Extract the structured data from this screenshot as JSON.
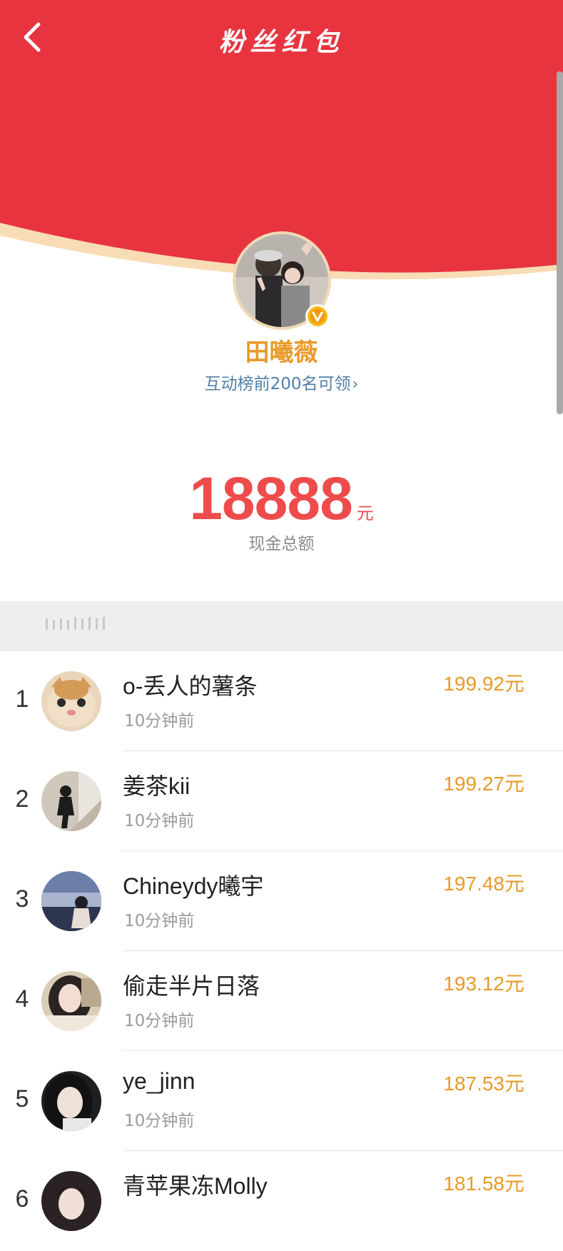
{
  "header": {
    "title": "粉丝红包",
    "back_icon": "chevron-left-icon",
    "background_color": "#e7343f",
    "rim_color": "#f7dcb5"
  },
  "host": {
    "name": "田曦薇",
    "badge_icon": "verified-v-badge-icon",
    "hint": "互动榜前200名可领"
  },
  "amount": {
    "value": "18888",
    "unit": "元",
    "label": "现金总额",
    "color": "#ee4c4c"
  },
  "list": {
    "items": [
      {
        "rank": "1",
        "name": "o-丢人的薯条",
        "time": "10分钟前",
        "amount": "199.92元"
      },
      {
        "rank": "2",
        "name": "姜茶kii",
        "time": "10分钟前",
        "amount": "199.27元"
      },
      {
        "rank": "3",
        "name": "Chineydy曦宇",
        "time": "10分钟前",
        "amount": "197.48元"
      },
      {
        "rank": "4",
        "name": "偷走半片日落",
        "time": "10分钟前",
        "amount": "193.12元"
      },
      {
        "rank": "5",
        "name": "ye_jinn",
        "time": "10分钟前",
        "amount": "187.53元"
      },
      {
        "rank": "6",
        "name": "青苹果冻Molly",
        "time": "",
        "amount": "181.58元"
      }
    ],
    "amount_color": "#e89a28"
  }
}
